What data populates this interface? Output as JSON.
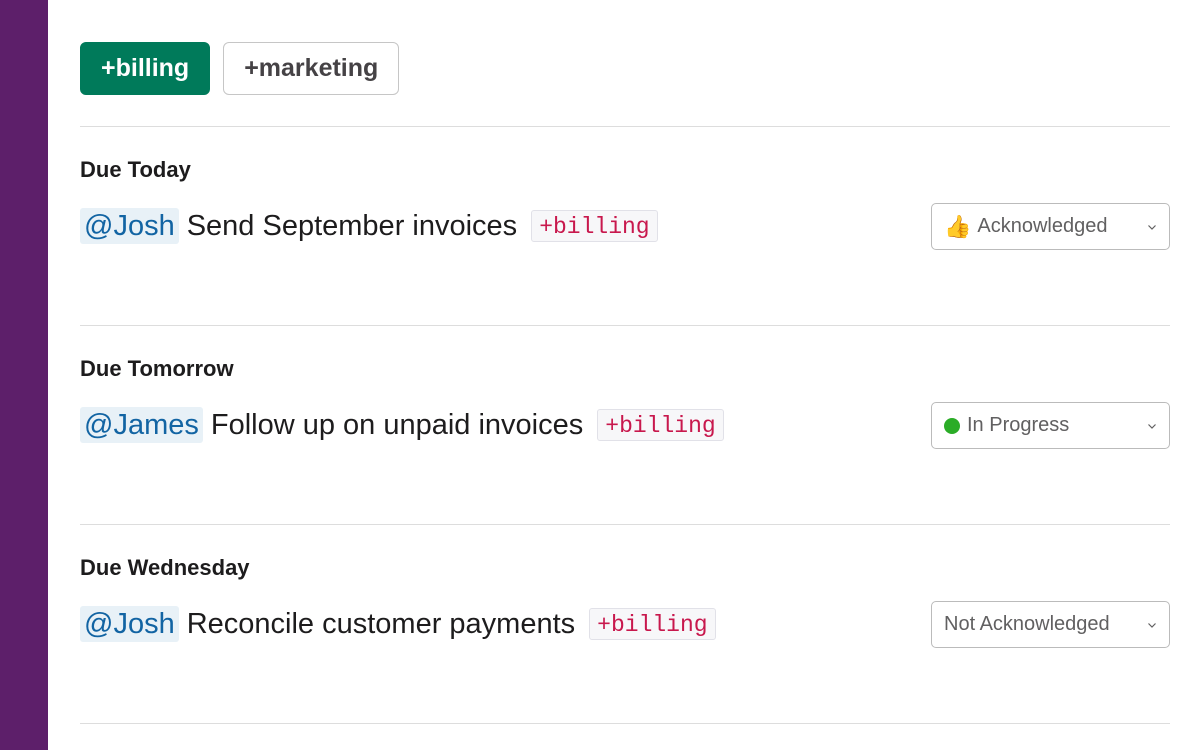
{
  "filters": [
    {
      "label": "+billing",
      "active": true
    },
    {
      "label": "+marketing",
      "active": false
    }
  ],
  "sections": [
    {
      "title": "Due Today",
      "mention": "@Josh",
      "task": "Send September invoices",
      "tag": "+billing",
      "status": {
        "icon": "thumbs-up-icon",
        "glyph": "👍",
        "label": "Acknowledged"
      }
    },
    {
      "title": "Due Tomorrow",
      "mention": "@James",
      "task": "Follow up on unpaid invoices",
      "tag": "+billing",
      "status": {
        "icon": "green-dot-icon",
        "label": "In Progress",
        "color": "#2bac27"
      }
    },
    {
      "title": "Due Wednesday",
      "mention": "@Josh",
      "task": "Reconcile customer payments",
      "tag": "+billing",
      "status": {
        "label": "Not Acknowledged"
      }
    }
  ],
  "colors": {
    "sidebar": "#5d1f6a",
    "active_filter": "#007a5a",
    "mention_text": "#1264a3",
    "mention_bg": "#e8f1f7",
    "tag_text": "#c8184d"
  }
}
